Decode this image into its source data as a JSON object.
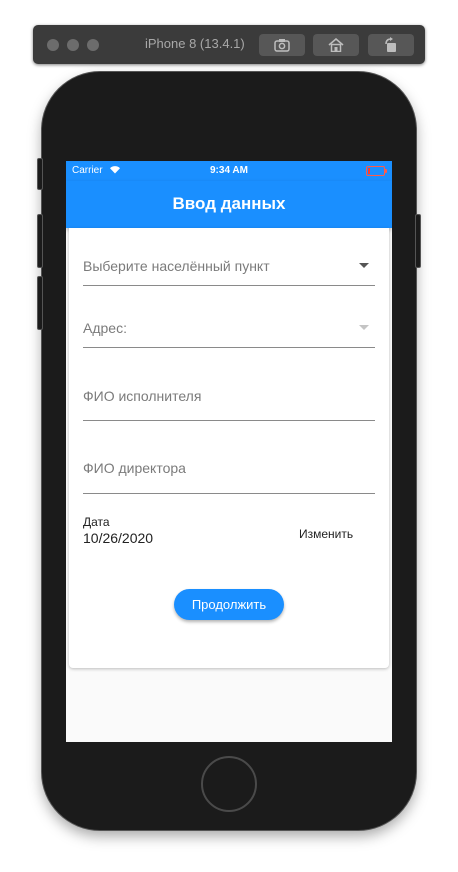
{
  "simulator": {
    "title": "iPhone 8 (13.4.1)",
    "buttons": [
      "screenshot-icon",
      "home-icon",
      "rotate-icon"
    ]
  },
  "status_bar": {
    "carrier": "Carrier",
    "time": "9:34 AM",
    "battery_color": "#ff3b30"
  },
  "app_bar": {
    "title": "Ввод данных",
    "color": "#1a8fff"
  },
  "form": {
    "settlement_dropdown": {
      "hint": "Выберите населённый пункт"
    },
    "address_dropdown": {
      "hint": "Адрес:"
    },
    "executor_field": {
      "placeholder": "ФИО исполнителя"
    },
    "director_field": {
      "placeholder": "ФИО директора"
    },
    "date": {
      "label": "Дата",
      "value": "10/26/2020",
      "change_label": "Изменить"
    },
    "continue_label": "Продолжить"
  }
}
